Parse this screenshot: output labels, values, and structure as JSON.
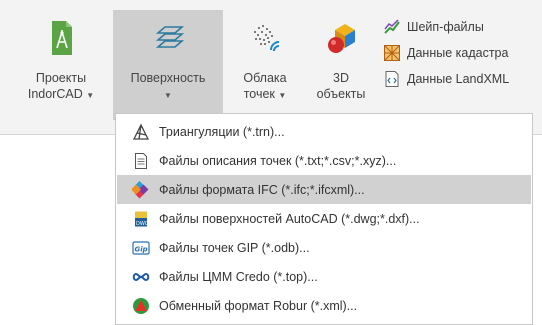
{
  "ribbon": {
    "projects": {
      "line1": "Проекты",
      "line2": "IndorCAD",
      "arrow": "▼"
    },
    "surface": {
      "line1": "Поверхность",
      "arrow": "▼"
    },
    "clouds": {
      "line1": "Облака",
      "line2": "точек",
      "arrow": "▼"
    },
    "objects3d": {
      "line1": "3D",
      "line2": "объекты"
    },
    "small": [
      {
        "label": "Шейп-файлы",
        "icon": "shapefile-icon"
      },
      {
        "label": "Данные кадастра",
        "icon": "cadastre-icon"
      },
      {
        "label": "Данные LandXML",
        "icon": "landxml-icon"
      }
    ]
  },
  "menu": {
    "items": [
      {
        "label": "Триангуляции (*.trn)...",
        "icon": "triangulation-icon",
        "highlighted": false
      },
      {
        "label": "Файлы описания точек (*.txt;*.csv;*.xyz)...",
        "icon": "document-icon",
        "highlighted": false
      },
      {
        "label": "Файлы формата IFC (*.ifc;*.ifcxml)...",
        "icon": "ifc-icon",
        "highlighted": true
      },
      {
        "label": "Файлы поверхностей AutoCAD (*.dwg;*.dxf)...",
        "icon": "autocad-icon",
        "highlighted": false
      },
      {
        "label": "Файлы точек GIP (*.odb)...",
        "icon": "gip-icon",
        "highlighted": false
      },
      {
        "label": "Файлы ЦММ Credo (*.top)...",
        "icon": "credo-icon",
        "highlighted": false
      },
      {
        "label": "Обменный формат Robur (*.xml)...",
        "icon": "robur-icon",
        "highlighted": false
      }
    ]
  },
  "colors": {
    "ribbon_bg": "#f3f3f3",
    "pressed_bg": "#cfcfcf",
    "highlight_bg": "#d1d1d1",
    "accent_green": "#4a9a3a"
  }
}
